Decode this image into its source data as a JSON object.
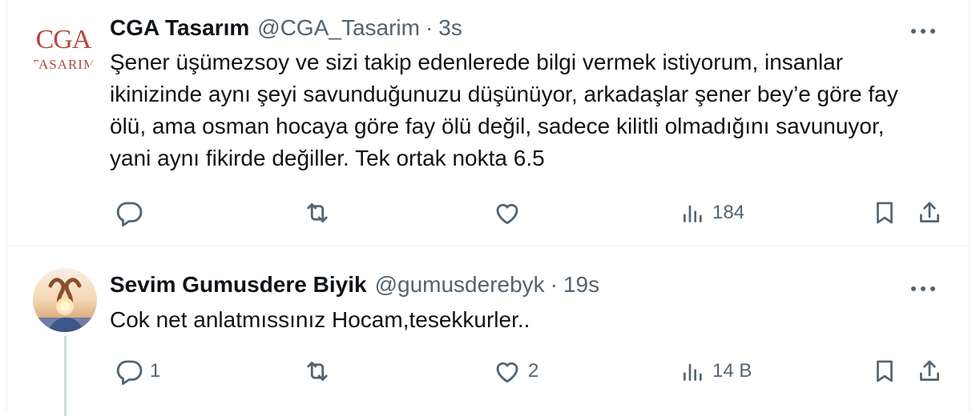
{
  "tweets": [
    {
      "author": {
        "name": "CGA Tasarım",
        "handle": "@CGA_Tasarim",
        "avatar_logo_text": "CGA",
        "avatar_logo_subtext": "TASARIM"
      },
      "separator": "·",
      "time": "3s",
      "text": "Şener üşümezsoy ve sizi takip edenlerede bilgi vermek istiyorum, insanlar ikinizinde aynı şeyi savunduğunuzu düşünüyor, arkadaşlar şener bey’e göre fay ölü, ama osman hocaya göre fay ölü değil, sadece kilitli olmadığını savunuyor, yani aynı fikirde değiller. Tek ortak nokta 6.5",
      "stats": {
        "replies": "",
        "retweets": "",
        "likes": "",
        "views": "184"
      }
    },
    {
      "author": {
        "name": "Sevim Gumusdere Biyik",
        "handle": "@gumusderebyk"
      },
      "separator": "·",
      "time": "19s",
      "text": "Cok net anlatmıssınız Hocam,tesekkurler..",
      "stats": {
        "replies": "1",
        "retweets": "",
        "likes": "2",
        "views": "14 B"
      }
    }
  ],
  "colors": {
    "text": "#0f1419",
    "secondary": "#536471",
    "border": "#eff3f4",
    "thread_line": "#cfd9de",
    "logo_red": "#b5473d"
  },
  "icons": [
    "reply-icon",
    "retweet-icon",
    "like-icon",
    "views-icon",
    "bookmark-icon",
    "share-icon",
    "more-icon"
  ]
}
